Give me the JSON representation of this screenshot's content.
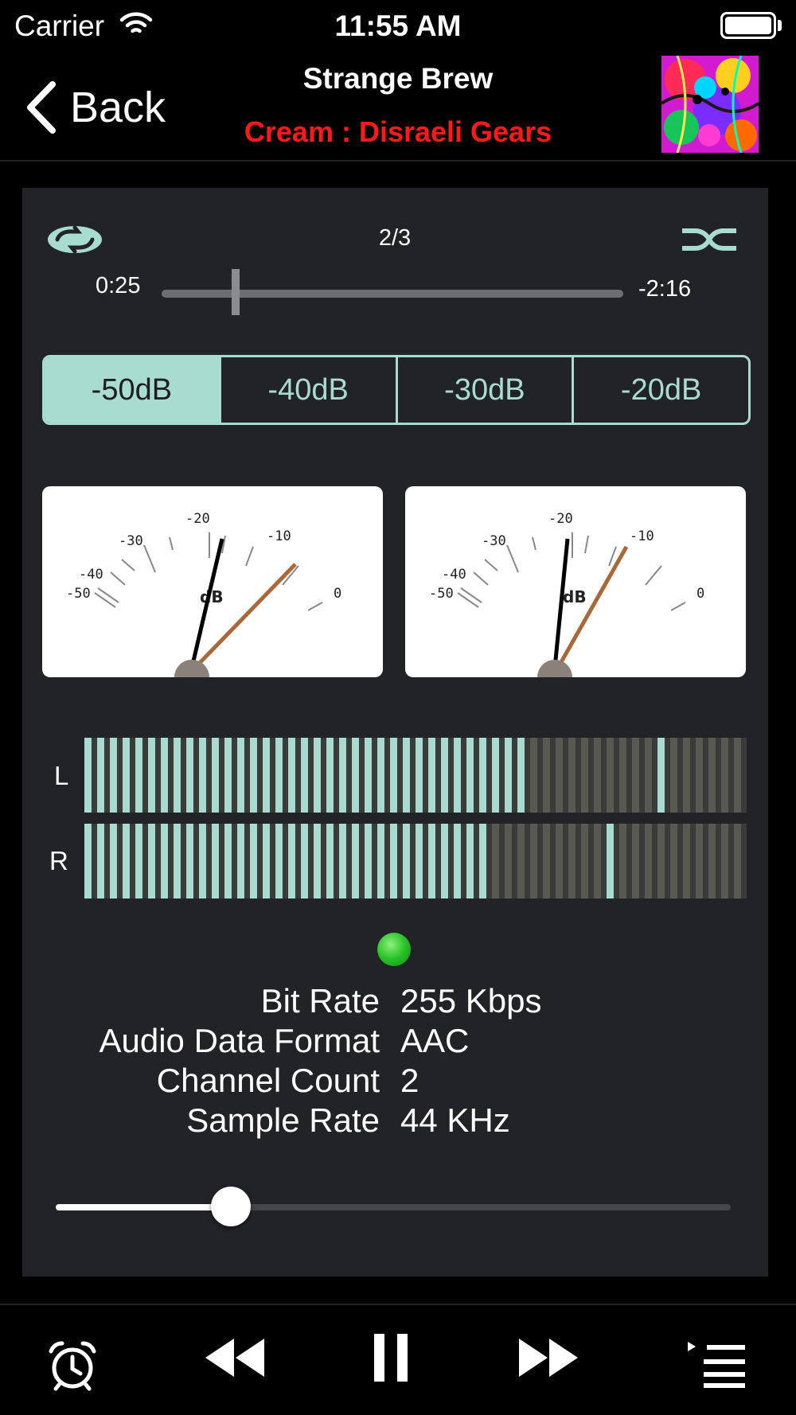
{
  "status_bar": {
    "carrier": "Carrier",
    "time": "11:55 AM"
  },
  "nav": {
    "back_label": "Back",
    "title": "Strange Brew",
    "subtitle": "Cream : Disraeli Gears",
    "subtitle_color": "#ff1a1a"
  },
  "player": {
    "track_counter": "2/3",
    "elapsed": "0:25",
    "remaining": "-2:16",
    "progress_fraction": 0.16
  },
  "db_range": {
    "options": [
      "-50dB",
      "-40dB",
      "-30dB",
      "-20dB"
    ],
    "selected": "-50dB"
  },
  "vu_meters": {
    "scale_labels": [
      "-50",
      "-40",
      "-30",
      "-20",
      "-10",
      "0"
    ],
    "unit": "dB",
    "left_peak_db": -11,
    "right_peak_db": -11
  },
  "level_bars": {
    "left_label": "L",
    "right_label": "R",
    "left_level_fraction": 0.68,
    "left_peak_fraction": 0.87,
    "right_level_fraction": 0.62,
    "right_peak_fraction": 0.79
  },
  "info": [
    {
      "label": "Bit Rate",
      "value": "255 Kbps"
    },
    {
      "label": "Audio Data Format",
      "value": "AAC"
    },
    {
      "label": "Channel Count",
      "value": "2"
    },
    {
      "label": "Sample Rate",
      "value": "44 KHz"
    }
  ],
  "volume": {
    "fraction": 0.26
  },
  "toolbar": {
    "icons": [
      "alarm-clock-icon",
      "rewind-icon",
      "pause-icon",
      "fast-forward-icon",
      "playlist-icon"
    ]
  },
  "colors": {
    "accent": "#a8dcd1",
    "panel": "#222326",
    "bar_inactive": "#5a5a55",
    "led": "#27c227"
  }
}
